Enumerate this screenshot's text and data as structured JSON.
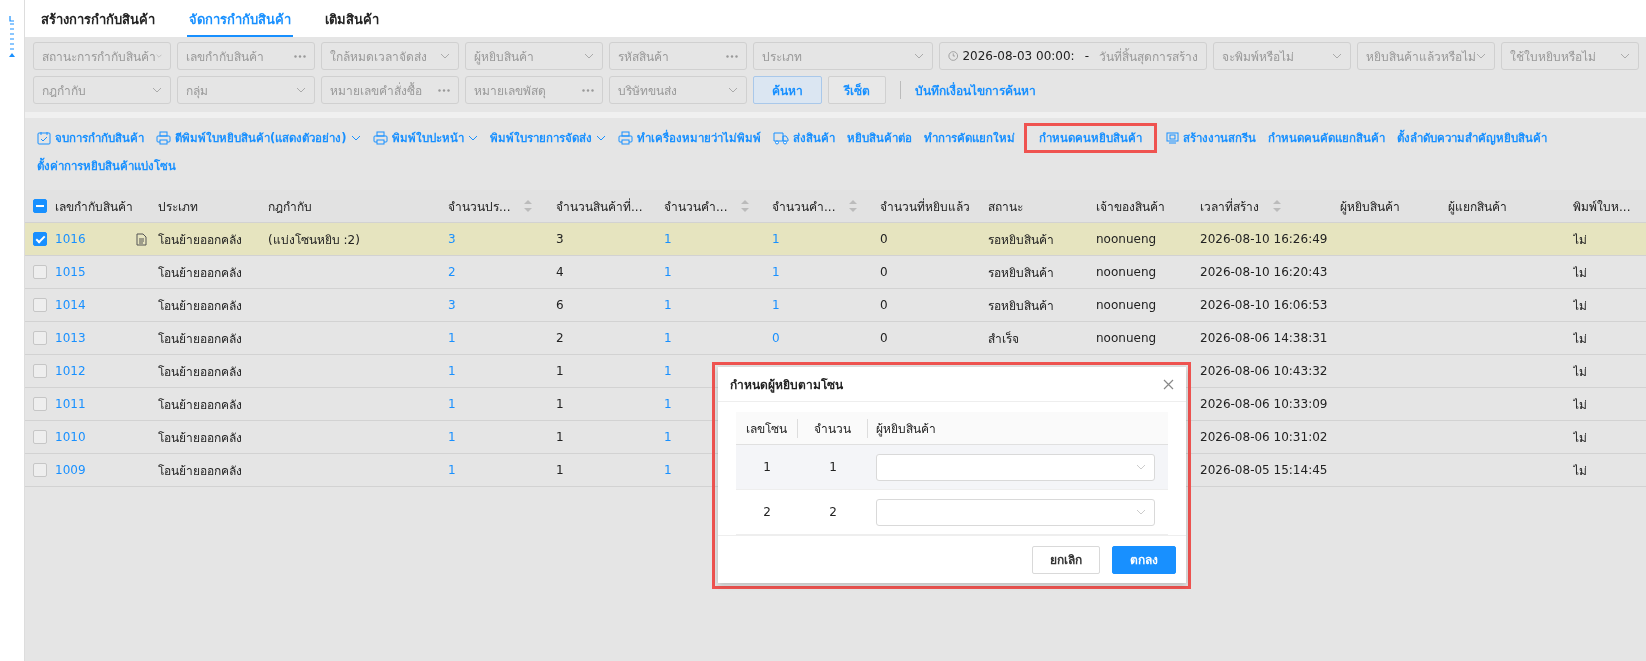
{
  "tabs": [
    {
      "label": "สร้างการกำกับสินค้า",
      "selected": false
    },
    {
      "label": "จัดการกำกับสินค้า",
      "selected": true
    },
    {
      "label": "เติมสินค้า",
      "selected": false
    }
  ],
  "filters": {
    "row_1": [
      {
        "kind": "select",
        "placeholder": "สถานะการกำกับสินค้า"
      },
      {
        "kind": "text",
        "placeholder": "เลขกำกับสินค้า"
      },
      {
        "kind": "select",
        "placeholder": "ใกล้หมดเวลาจัดส่ง"
      },
      {
        "kind": "select",
        "placeholder": "ผู้หยิบสินค้า"
      },
      {
        "kind": "text",
        "placeholder": "รหัสสินค้า"
      },
      {
        "kind": "select",
        "placeholder": "ประเภท",
        "wide": true
      },
      {
        "kind": "date-range",
        "value": "2026-08-03 00:00:",
        "separator": "-",
        "placeholder": "วันที่สิ้นสุดการสร้าง"
      },
      {
        "kind": "select",
        "placeholder": "จะพิมพ์หรือไม่"
      },
      {
        "kind": "select",
        "placeholder": "หยิบสินค้าแล้วหรือไม่"
      },
      {
        "kind": "select",
        "placeholder": "ใช้ใบหยิบหรือไม่"
      }
    ],
    "row_2": [
      {
        "kind": "select",
        "placeholder": "กฎกำกับ"
      },
      {
        "kind": "select",
        "placeholder": "กลุ่ม"
      },
      {
        "kind": "text",
        "placeholder": "หมายเลขคำสั่งซื้อ"
      },
      {
        "kind": "text",
        "placeholder": "หมายเลขพัสดุ"
      },
      {
        "kind": "select",
        "placeholder": "บริษัทขนส่ง"
      }
    ],
    "search_button": "ค้นหา",
    "reset_button": "รีเซ็ต",
    "save_link": "บันทึกเงื่อนไขการค้นหา"
  },
  "toolbar": [
    {
      "label": "จบการกำกับสินค้า",
      "kind": "calendar-check",
      "dropdown": false,
      "highlighted": false
    },
    {
      "label": "ตีพิมพ์ใบหยิบสินค้า(แสดงตัวอย่าง)",
      "kind": "printer",
      "dropdown": true,
      "highlighted": false
    },
    {
      "label": "พิมพ์ใบปะหน้า",
      "kind": "printer",
      "dropdown": true,
      "highlighted": false
    },
    {
      "label": "พิมพ์ใบรายการจัดส่ง",
      "kind": "plain",
      "dropdown": true,
      "highlighted": false
    },
    {
      "label": "ทำเครื่องหมายว่าไม่พิมพ์",
      "kind": "printer",
      "dropdown": false,
      "highlighted": false
    },
    {
      "label": "ส่งสินค้า",
      "kind": "truck",
      "dropdown": false,
      "highlighted": false
    },
    {
      "label": "หยิบสินค้าต่อ",
      "kind": "plain",
      "dropdown": false,
      "highlighted": false
    },
    {
      "label": "ทำการคัดแยกใหม่",
      "kind": "plain",
      "dropdown": false,
      "highlighted": false
    },
    {
      "label": "กำหนดคนหยิบสินค้า",
      "kind": "plain",
      "dropdown": false,
      "highlighted": true
    },
    {
      "label": "สร้างงานสกรีน",
      "kind": "screen",
      "dropdown": false,
      "highlighted": false
    },
    {
      "label": "กำหนดคนคัดแยกสินค้า",
      "kind": "plain",
      "dropdown": false,
      "highlighted": false
    },
    {
      "label": "ตั้งลำดับความสำคัญหยิบสินค้า",
      "kind": "plain",
      "dropdown": false,
      "highlighted": false
    },
    {
      "label": "ตั้งค่าการหยิบสินค้าแบ่งโซน",
      "kind": "plain",
      "dropdown": false,
      "highlighted": false
    }
  ],
  "table": {
    "select_all_indeterminate": true,
    "columns": [
      {
        "label": "เลขกำกับสินค้า",
        "sortable": false
      },
      {
        "label": "ประเภท",
        "sortable": false
      },
      {
        "label": "กฎกำกับ",
        "sortable": false
      },
      {
        "label": "จำนวนปร...",
        "sortable": true
      },
      {
        "label": "จำนวนสินค้าที่...",
        "sortable": false
      },
      {
        "label": "จำนวนคำ...",
        "sortable": true
      },
      {
        "label": "จำนวนคำ...",
        "sortable": true
      },
      {
        "label": "จำนวนที่หยิบแล้ว",
        "sortable": false
      },
      {
        "label": "สถานะ",
        "sortable": false
      },
      {
        "label": "เจ้าของสินค้า",
        "sortable": false
      },
      {
        "label": "เวลาที่สร้าง",
        "sortable": true
      },
      {
        "label": "ผู้หยิบสินค้า",
        "sortable": false
      },
      {
        "label": "ผู้แยกสินค้า",
        "sortable": false
      },
      {
        "label": "พิมพ์ใบห...",
        "sortable": false
      }
    ],
    "rows": [
      {
        "selected": true,
        "has_note": true,
        "cells": [
          "1016",
          "โอนย้ายออกคลัง",
          "(แบ่งโซนหยิบ :2)",
          "3",
          "3",
          "1",
          "1",
          "0",
          "รอหยิบสินค้า",
          "noonueng",
          "2026-08-10 16:26:49",
          "",
          "",
          "ไม่"
        ]
      },
      {
        "selected": false,
        "has_note": false,
        "cells": [
          "1015",
          "โอนย้ายออกคลัง",
          "",
          "2",
          "4",
          "1",
          "1",
          "0",
          "รอหยิบสินค้า",
          "noonueng",
          "2026-08-10 16:20:43",
          "",
          "",
          "ไม่"
        ]
      },
      {
        "selected": false,
        "has_note": false,
        "cells": [
          "1014",
          "โอนย้ายออกคลัง",
          "",
          "3",
          "6",
          "1",
          "1",
          "0",
          "รอหยิบสินค้า",
          "noonueng",
          "2026-08-10 16:06:53",
          "",
          "",
          "ไม่"
        ]
      },
      {
        "selected": false,
        "has_note": false,
        "cells": [
          "1013",
          "โอนย้ายออกคลัง",
          "",
          "1",
          "2",
          "1",
          "0",
          "0",
          "สำเร็จ",
          "noonueng",
          "2026-08-06 14:38:31",
          "",
          "",
          "ไม่"
        ]
      },
      {
        "selected": false,
        "has_note": false,
        "cells": [
          "1012",
          "โอนย้ายออกคลัง",
          "",
          "1",
          "1",
          "1",
          "",
          "",
          "",
          "",
          "2026-08-06 10:43:32",
          "",
          "",
          "ไม่"
        ]
      },
      {
        "selected": false,
        "has_note": false,
        "cells": [
          "1011",
          "โอนย้ายออกคลัง",
          "",
          "1",
          "1",
          "1",
          "",
          "",
          "",
          "",
          "2026-08-06 10:33:09",
          "",
          "",
          "ไม่"
        ]
      },
      {
        "selected": false,
        "has_note": false,
        "cells": [
          "1010",
          "โอนย้ายออกคลัง",
          "",
          "1",
          "1",
          "1",
          "",
          "",
          "",
          "",
          "2026-08-06 10:31:02",
          "",
          "",
          "ไม่"
        ]
      },
      {
        "selected": false,
        "has_note": false,
        "cells": [
          "1009",
          "โอนย้ายออกคลัง",
          "",
          "1",
          "1",
          "1",
          "",
          "",
          "",
          "",
          "2026-08-05 15:14:45",
          "",
          "",
          "ไม่"
        ]
      }
    ]
  },
  "modal": {
    "title": "กำหนดผู้หยิบตามโซน",
    "highlighted": true,
    "columns": [
      "เลขโซน",
      "จำนวน",
      "ผู้หยิบสินค้า"
    ],
    "rows": [
      {
        "zone": "1",
        "count": "1"
      },
      {
        "zone": "2",
        "count": "2"
      }
    ],
    "cancel_button": "ยกเลิก",
    "ok_button": "ตกลง"
  }
}
